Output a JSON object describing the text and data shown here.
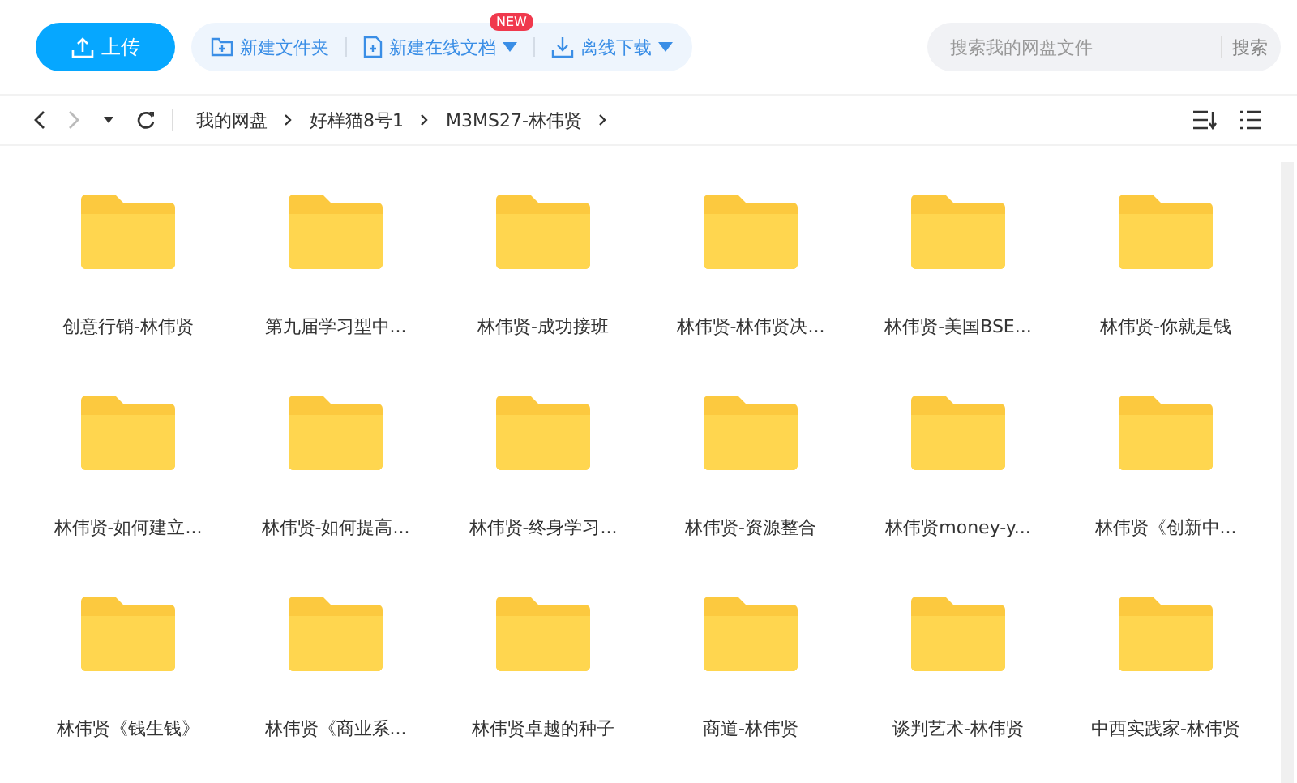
{
  "toolbar": {
    "upload": "上传",
    "new_folder": "新建文件夹",
    "new_doc": "新建在线文档",
    "new_badge": "NEW",
    "offline_download": "离线下载"
  },
  "search": {
    "placeholder": "搜索我的网盘文件",
    "button": "搜索"
  },
  "breadcrumb": [
    "我的网盘",
    "好样猫8号1",
    "M3MS27-林伟贤"
  ],
  "folders": [
    {
      "name": "创意行销-林伟贤"
    },
    {
      "name": "第九届学习型中..."
    },
    {
      "name": "林伟贤-成功接班"
    },
    {
      "name": "林伟贤-林伟贤决..."
    },
    {
      "name": "林伟贤-美国BSE..."
    },
    {
      "name": "林伟贤-你就是钱"
    },
    {
      "name": "林伟贤-如何建立..."
    },
    {
      "name": "林伟贤-如何提高..."
    },
    {
      "name": "林伟贤-终身学习..."
    },
    {
      "name": "林伟贤-资源整合"
    },
    {
      "name": "林伟贤money-y..."
    },
    {
      "name": "林伟贤《创新中..."
    },
    {
      "name": "林伟贤《钱生钱》"
    },
    {
      "name": "林伟贤《商业系..."
    },
    {
      "name": "林伟贤卓越的种子"
    },
    {
      "name": "商道-林伟贤"
    },
    {
      "name": "谈判艺术-林伟贤"
    },
    {
      "name": "中西实践家-林伟贤"
    }
  ]
}
